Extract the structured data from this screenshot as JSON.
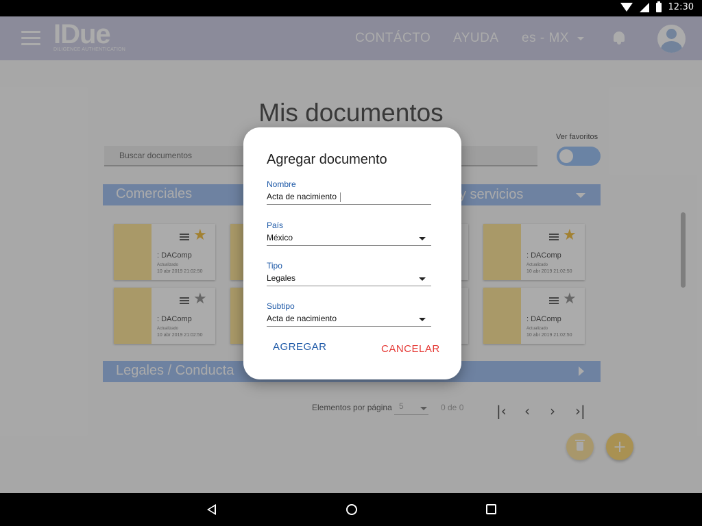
{
  "status_bar": {
    "time": "12:30"
  },
  "app_bar": {
    "logo": "IDue",
    "logo_tagline": "DILIGENCE AUTHENTICATION",
    "nav": {
      "contact": "CONTÁCTO",
      "help": "AYUDA",
      "language": "es - MX"
    }
  },
  "main": {
    "title": "Mis documentos",
    "search_placeholder": "Buscar documentos",
    "favorites_label": "Ver favoritos",
    "sections": [
      {
        "label": "Comerciales",
        "label_right": "y servicios"
      },
      {
        "label": "Legales / Conducta"
      }
    ],
    "cards": [
      {
        "name": ": DAComp",
        "updated_label": "Actualizado",
        "date": "10 abr 2019 21:02:50",
        "favorite": true
      },
      {
        "name": ": DAComp",
        "updated_label": "Actualizado",
        "date": "10 abr 2019 21:02:50",
        "favorite": true
      },
      {
        "name": ": DAComp",
        "updated_label": "Actualizado",
        "date": "10 abr 2019 21:02:50",
        "favorite": false
      },
      {
        "name": ": DAComp",
        "updated_label": "Actualizado",
        "date": "10 abr 2019 21:02:50",
        "favorite": false
      }
    ],
    "pagination": {
      "label": "Elementos por página",
      "per_page": "5",
      "count": "0 de 0"
    }
  },
  "dialog": {
    "title": "Agregar documento",
    "fields": {
      "nombre": {
        "label": "Nombre",
        "value": "Acta de nacimiento"
      },
      "pais": {
        "label": "País",
        "value": "México"
      },
      "tipo": {
        "label": "Tipo",
        "value": "Legales"
      },
      "subtipo": {
        "label": "Subtipo",
        "value": "Acta de nacimiento"
      }
    },
    "buttons": {
      "add": "AGREGAR",
      "cancel": "CANCELAR"
    }
  },
  "colors": {
    "app_bar": "#d0d0e6",
    "section_bar": "#a5c2f0",
    "label_blue": "#1b57a6",
    "cancel_red": "#e53935",
    "card_thumb": "#fde59c",
    "fab": "#fcd97b"
  }
}
